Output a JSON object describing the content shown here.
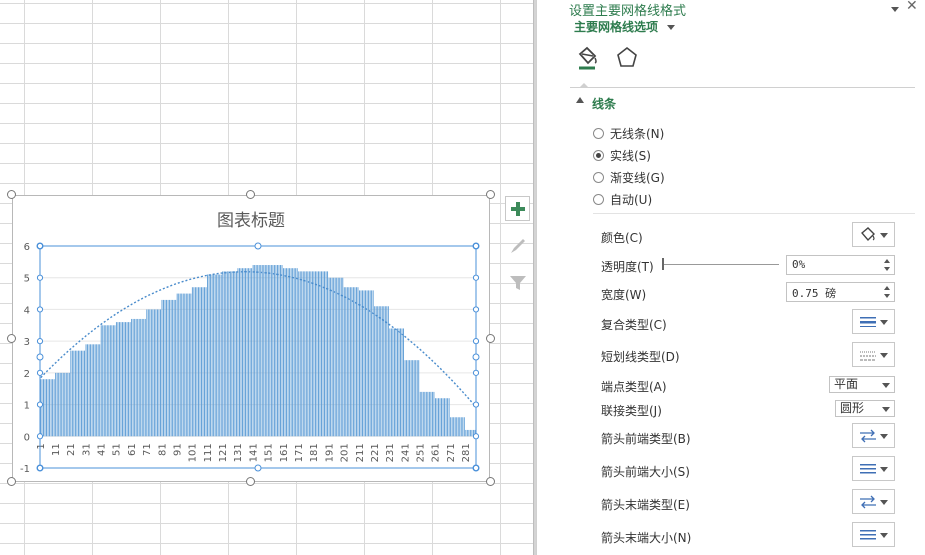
{
  "chart": {
    "title": "图表标题",
    "colors": {
      "bar": "#5b9bd5",
      "trend": "#4a8ccc",
      "frame": "#4a90d9"
    }
  },
  "chart_data": {
    "type": "bar",
    "ylim": [
      -1,
      6
    ],
    "yticks": [
      "-1",
      "0",
      "1",
      "2",
      "3",
      "4",
      "5",
      "6"
    ],
    "xticks": [
      "1",
      "11",
      "21",
      "31",
      "41",
      "51",
      "61",
      "71",
      "81",
      "91",
      "101",
      "111",
      "121",
      "131",
      "141",
      "151",
      "161",
      "171",
      "181",
      "191",
      "201",
      "211",
      "221",
      "231",
      "241",
      "251",
      "261",
      "271",
      "281"
    ],
    "categories_count": 287,
    "values_step": [
      1.8,
      2.0,
      2.7,
      2.9,
      3.5,
      3.6,
      3.7,
      4.0,
      4.3,
      4.5,
      4.7,
      5.1,
      5.2,
      5.3,
      5.4,
      5.4,
      5.3,
      5.2,
      5.2,
      5.0,
      4.7,
      4.6,
      4.1,
      3.4,
      2.4,
      1.4,
      1.2,
      0.6,
      0.2
    ],
    "trendline": "polynomial",
    "grid": true
  },
  "side_buttons": {
    "add": "chart-elements-icon",
    "style": "chart-styles-icon",
    "filter": "chart-filters-icon"
  },
  "pane": {
    "title": "设置主要网格线格式",
    "subtitle": "主要网格线选项",
    "section": "线条",
    "line_options": [
      {
        "label": "无线条(N)",
        "selected": false
      },
      {
        "label": "实线(S)",
        "selected": true
      },
      {
        "label": "渐变线(G)",
        "selected": false
      },
      {
        "label": "自动(U)",
        "selected": false
      }
    ],
    "props": {
      "color": "颜色(C)",
      "transparency": "透明度(T)",
      "transparency_value": "0%",
      "width": "宽度(W)",
      "width_value": "0.75 磅",
      "compound": "复合类型(C)",
      "dash": "短划线类型(D)",
      "cap": "端点类型(A)",
      "cap_value": "平面",
      "join": "联接类型(J)",
      "join_value": "圆形",
      "begin_arrow_type": "箭头前端类型(B)",
      "begin_arrow_size": "箭头前端大小(S)",
      "end_arrow_type": "箭头末端类型(E)",
      "end_arrow_size": "箭头末端大小(N)"
    },
    "accent_color": "#2e7c4e"
  }
}
